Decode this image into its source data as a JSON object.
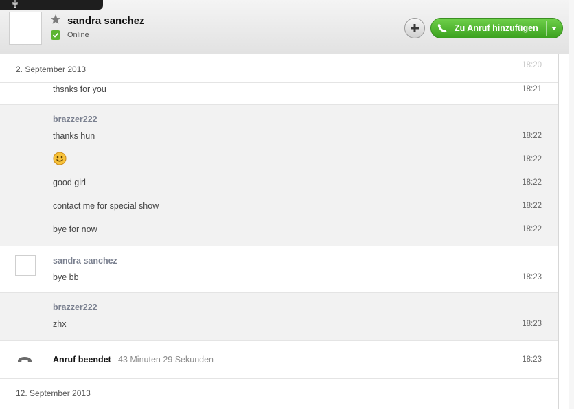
{
  "header": {
    "contact_name": "sandra sanchez",
    "status": "Online",
    "call_button_label": "Zu Anruf hinzufügen"
  },
  "conversation": {
    "date_1": "2. September 2013",
    "date_2": "12. September 2013",
    "faded_time": "18:20",
    "first_message": {
      "text": "thsnks for you",
      "time": "18:21"
    },
    "group_1": {
      "sender": "brazzer222",
      "messages": [
        {
          "text": "thanks hun",
          "time": "18:22"
        },
        {
          "emoji": "smiley-emoji",
          "time": "18:22"
        },
        {
          "text": "good girl",
          "time": "18:22"
        },
        {
          "text": "contact me for special show",
          "time": "18:22"
        },
        {
          "text": "bye for now",
          "time": "18:22"
        }
      ]
    },
    "group_2": {
      "sender": "sandra sanchez",
      "messages": [
        {
          "text": "bye bb",
          "time": "18:23"
        }
      ]
    },
    "group_3": {
      "sender": "brazzer222",
      "messages": [
        {
          "text": "zhx",
          "time": "18:23"
        }
      ]
    },
    "call_event": {
      "label": "Anruf beendet",
      "duration": "43 Minuten 29 Sekunden",
      "time": "18:23"
    }
  },
  "colors": {
    "call_green": "#3ba11f",
    "sender_gray": "#7b8190",
    "status_green": "#5cb531"
  }
}
